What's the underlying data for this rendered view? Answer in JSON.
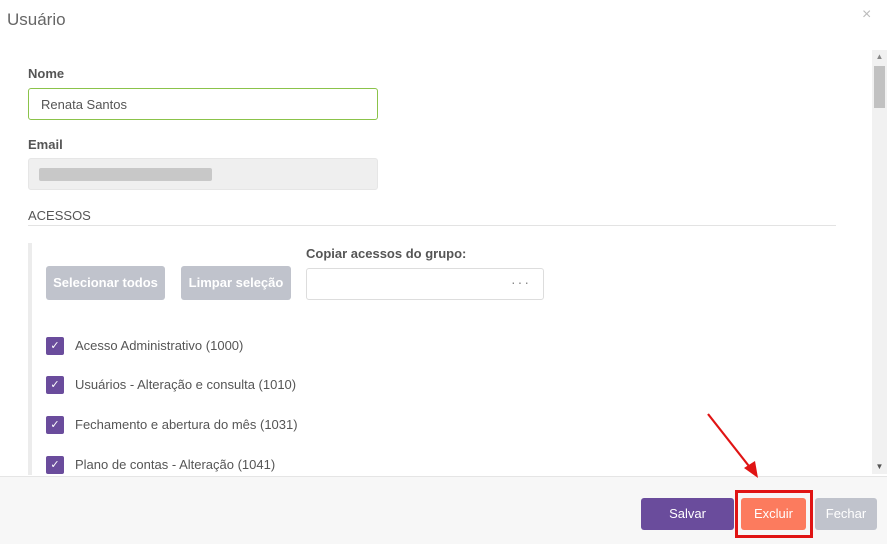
{
  "modal": {
    "title": "Usuário",
    "close_symbol": "×"
  },
  "form": {
    "name_label": "Nome",
    "name_value": "Renata Santos",
    "email_label": "Email"
  },
  "accesses": {
    "section_title": "ACESSOS",
    "select_all_label": "Selecionar todos",
    "clear_selection_label": "Limpar seleção",
    "copy_group_label": "Copiar acessos do grupo:",
    "copy_group_placeholder_icon": "···",
    "items": [
      {
        "label": "Acesso Administrativo (1000)",
        "checked": true
      },
      {
        "label": "Usuários - Alteração e consulta (1010)",
        "checked": true
      },
      {
        "label": "Fechamento e abertura do mês (1031)",
        "checked": true
      },
      {
        "label": "Plano de contas - Alteração (1041)",
        "checked": true
      }
    ]
  },
  "footer": {
    "save_label": "Salvar",
    "delete_label": "Excluir",
    "close_label": "Fechar"
  },
  "colors": {
    "primary": "#6a4c9c",
    "danger": "#fc7b5e",
    "disabled": "#c0c3cc",
    "valid_border": "#8bc34a",
    "annotation": "#e01414"
  },
  "icons": {
    "check": "check-icon",
    "close": "close-icon",
    "more": "more-dots-icon"
  }
}
